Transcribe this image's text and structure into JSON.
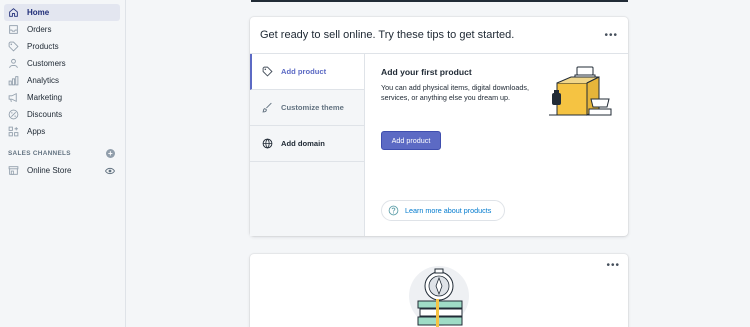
{
  "sidebar": {
    "items": [
      {
        "label": "Home",
        "icon": "home-icon",
        "active": true
      },
      {
        "label": "Orders",
        "icon": "orders-icon"
      },
      {
        "label": "Products",
        "icon": "tag-icon"
      },
      {
        "label": "Customers",
        "icon": "person-icon"
      },
      {
        "label": "Analytics",
        "icon": "bar-chart-icon"
      },
      {
        "label": "Marketing",
        "icon": "megaphone-icon"
      },
      {
        "label": "Discounts",
        "icon": "discount-icon"
      },
      {
        "label": "Apps",
        "icon": "apps-icon"
      }
    ],
    "section_label": "SALES CHANNELS",
    "online_store": "Online Store"
  },
  "card": {
    "title": "Get ready to sell online. Try these tips to get started.",
    "menu": "•••",
    "tabs": [
      {
        "label": "Add product",
        "icon": "tag-icon"
      },
      {
        "label": "Customize theme",
        "icon": "brush-icon"
      },
      {
        "label": "Add domain",
        "icon": "globe-icon"
      }
    ],
    "panel": {
      "title": "Add your first product",
      "text": "You can add physical items, digital downloads, services, or anything else you dream up.",
      "button": "Add product",
      "learn_more": "Learn more about products"
    }
  },
  "card2": {
    "menu": "•••"
  },
  "colors": {
    "accent": "#5c6ac4",
    "link": "#007ace",
    "illustration_yellow": "#f5c342"
  }
}
